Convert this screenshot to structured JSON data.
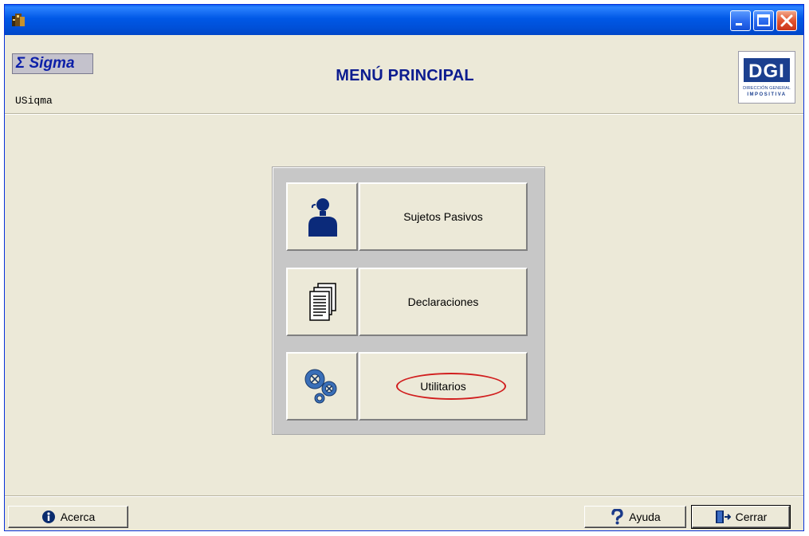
{
  "window": {
    "app_icon": "app-icon",
    "controls": [
      "minimize-icon",
      "maximize-icon",
      "close-icon"
    ]
  },
  "header": {
    "brand_label": "Σ Sigma",
    "user_label": "USiqma",
    "title": "MENÚ PRINCIPAL",
    "logo": {
      "mark": "DGI",
      "line1": "DIRECCIÓN GENERAL",
      "line2": "IMPOSITIVA"
    }
  },
  "menu": {
    "items": [
      {
        "label": "Sujetos Pasivos",
        "icon": "person-icon"
      },
      {
        "label": "Declaraciones",
        "icon": "documents-icon"
      },
      {
        "label": "Utilitarios",
        "icon": "gears-icon",
        "highlighted": true
      }
    ]
  },
  "footer": {
    "about_label": "Acerca",
    "help_label": "Ayuda",
    "close_label": "Cerrar"
  },
  "colors": {
    "window_bg": "#ece9d8",
    "titlebar": "#0058e6",
    "title_text": "#0c1c8f",
    "highlight": "#d11e1e"
  }
}
